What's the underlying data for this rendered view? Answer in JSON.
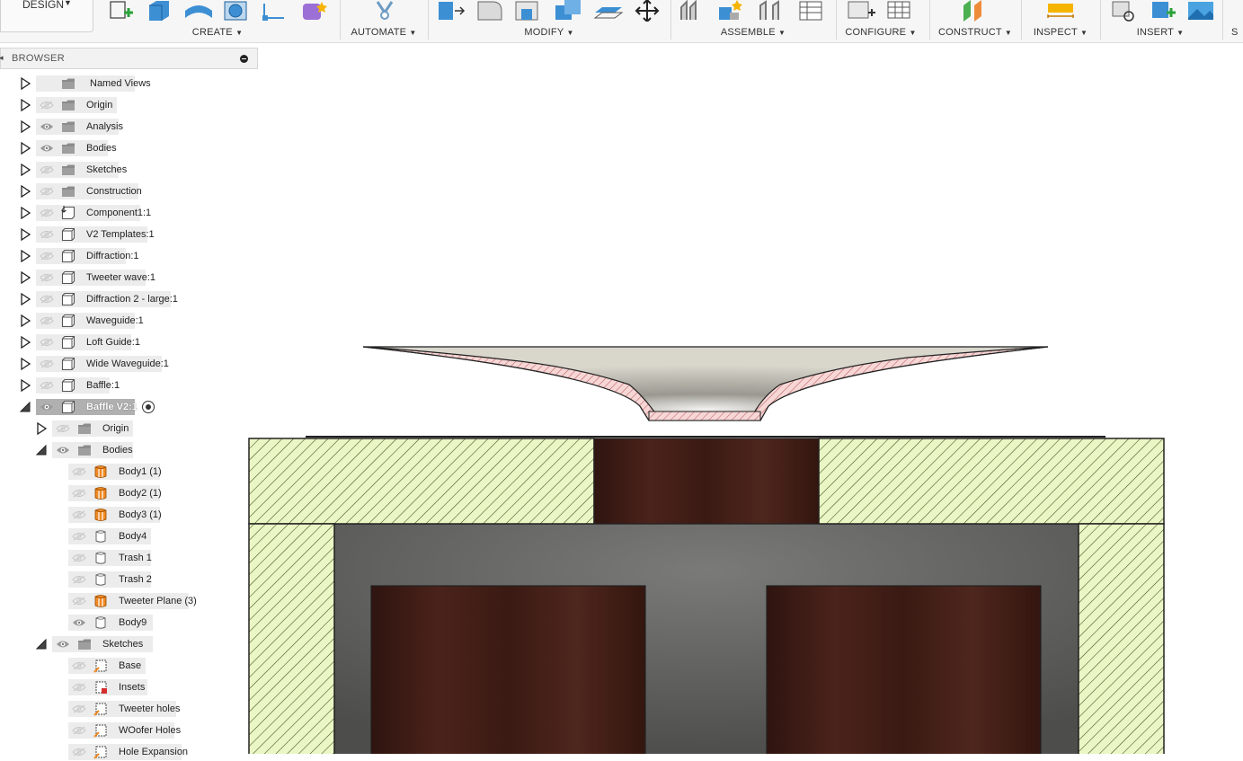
{
  "toolbar": {
    "workspace": "DESIGN",
    "groups": [
      {
        "label": "CREATE"
      },
      {
        "label": "AUTOMATE"
      },
      {
        "label": "MODIFY"
      },
      {
        "label": "ASSEMBLE"
      },
      {
        "label": "CONFIGURE"
      },
      {
        "label": "CONSTRUCT"
      },
      {
        "label": "INSPECT"
      },
      {
        "label": "INSERT"
      },
      {
        "label": "S"
      }
    ]
  },
  "browser": {
    "title": "BROWSER",
    "items": [
      {
        "label": "Named Views",
        "icon": "folder-icon"
      },
      {
        "label": "Origin",
        "icon": "folder-icon"
      },
      {
        "label": "Analysis",
        "icon": "folder-icon"
      },
      {
        "label": "Bodies",
        "icon": "folder-icon"
      },
      {
        "label": "Sketches",
        "icon": "folder-icon"
      },
      {
        "label": "Construction",
        "icon": "folder-icon"
      },
      {
        "label": "Component1:1",
        "icon": "component-anchored-icon"
      },
      {
        "label": "V2 Templates:1",
        "icon": "component-icon"
      },
      {
        "label": "Diffraction:1",
        "icon": "component-icon"
      },
      {
        "label": "Tweeter wave:1",
        "icon": "component-icon"
      },
      {
        "label": "Diffraction 2 - large:1",
        "icon": "component-icon"
      },
      {
        "label": "Waveguide:1",
        "icon": "component-icon"
      },
      {
        "label": "Loft Guide:1",
        "icon": "component-icon"
      },
      {
        "label": "Wide Waveguide:1",
        "icon": "component-icon"
      },
      {
        "label": "Baffle:1",
        "icon": "component-icon"
      },
      {
        "label": "Baffle V2:1",
        "icon": "component-icon"
      },
      {
        "label": "Origin",
        "icon": "folder-icon"
      },
      {
        "label": "Bodies",
        "icon": "folder-icon"
      },
      {
        "label": "Body1 (1)",
        "icon": "body-orange-icon"
      },
      {
        "label": "Body2 (1)",
        "icon": "body-orange-icon"
      },
      {
        "label": "Body3 (1)",
        "icon": "body-orange-icon"
      },
      {
        "label": "Body4",
        "icon": "body-icon"
      },
      {
        "label": "Trash 1",
        "icon": "body-icon"
      },
      {
        "label": "Trash 2",
        "icon": "body-icon"
      },
      {
        "label": "Tweeter Plane (3)",
        "icon": "body-orange-icon"
      },
      {
        "label": "Body9",
        "icon": "body-icon"
      },
      {
        "label": "Sketches",
        "icon": "folder-icon"
      },
      {
        "label": "Base",
        "icon": "sketch-icon"
      },
      {
        "label": "Insets",
        "icon": "sketch-locked-icon"
      },
      {
        "label": "Tweeter holes",
        "icon": "sketch-icon"
      },
      {
        "label": "WOofer Holes",
        "icon": "sketch-icon"
      },
      {
        "label": "Hole Expansion",
        "icon": "sketch-icon"
      }
    ]
  },
  "colors": {
    "hatch_fill": "#eaf7c4",
    "hatch_line": "#3a4a20",
    "wood": "#3b1a14",
    "cavity": "#5e5e5c",
    "horn_section": "#f4c9c9",
    "accent_blue": "#2e86c9"
  }
}
